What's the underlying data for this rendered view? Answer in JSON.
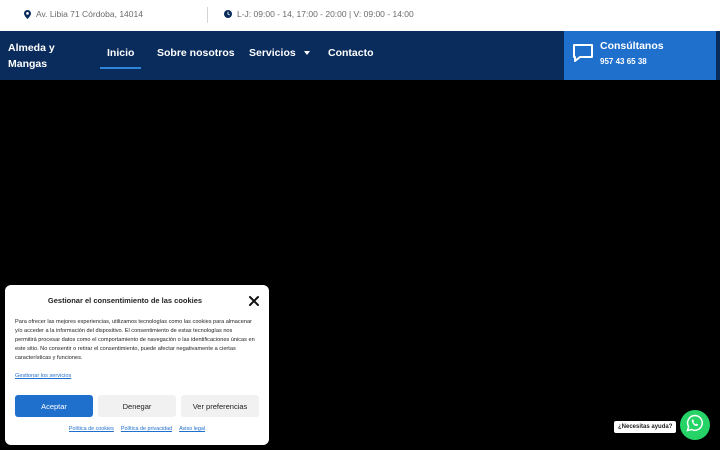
{
  "topbar": {
    "address": "Av. Libia 71 Córdoba, 14014",
    "hours": "L-J: 09:00 - 14, 17:00 - 20:00 | V: 09:00 - 14:00"
  },
  "header": {
    "brand_line1": "Almeda y",
    "brand_line2": "Mangas",
    "nav": {
      "inicio": "Inicio",
      "sobre": "Sobre nosotros",
      "servicios": "Servicios",
      "contacto": "Contacto"
    },
    "consult": {
      "title": "Consúltanos",
      "phone": "957 43 65 38"
    }
  },
  "cookie": {
    "title": "Gestionar el consentimiento de las cookies",
    "body": "Para ofrecer las mejores experiencias, utilizamos tecnologías como las cookies para almacenar y/o acceder a la información del dispositivo. El consentimiento de estas tecnologías nos permitirá procesar datos como el comportamiento de navegación o las identificaciones únicas en este sitio. No consentir o retirar el consentimiento, puede afectar negativamente a ciertas características y funciones.",
    "manage": "Gestionar los servicios",
    "accept": "Aceptar",
    "deny": "Denegar",
    "prefs": "Ver preferencias",
    "link_cookies": "Política de cookies",
    "link_privacy": "Política de privacidad",
    "link_legal": "Aviso legal"
  },
  "whatsapp": {
    "label": "¿Necesitas ayuda?"
  },
  "colors": {
    "header_bg": "#0a2c5c",
    "accent": "#1f6fcd",
    "whatsapp": "#25d366"
  }
}
